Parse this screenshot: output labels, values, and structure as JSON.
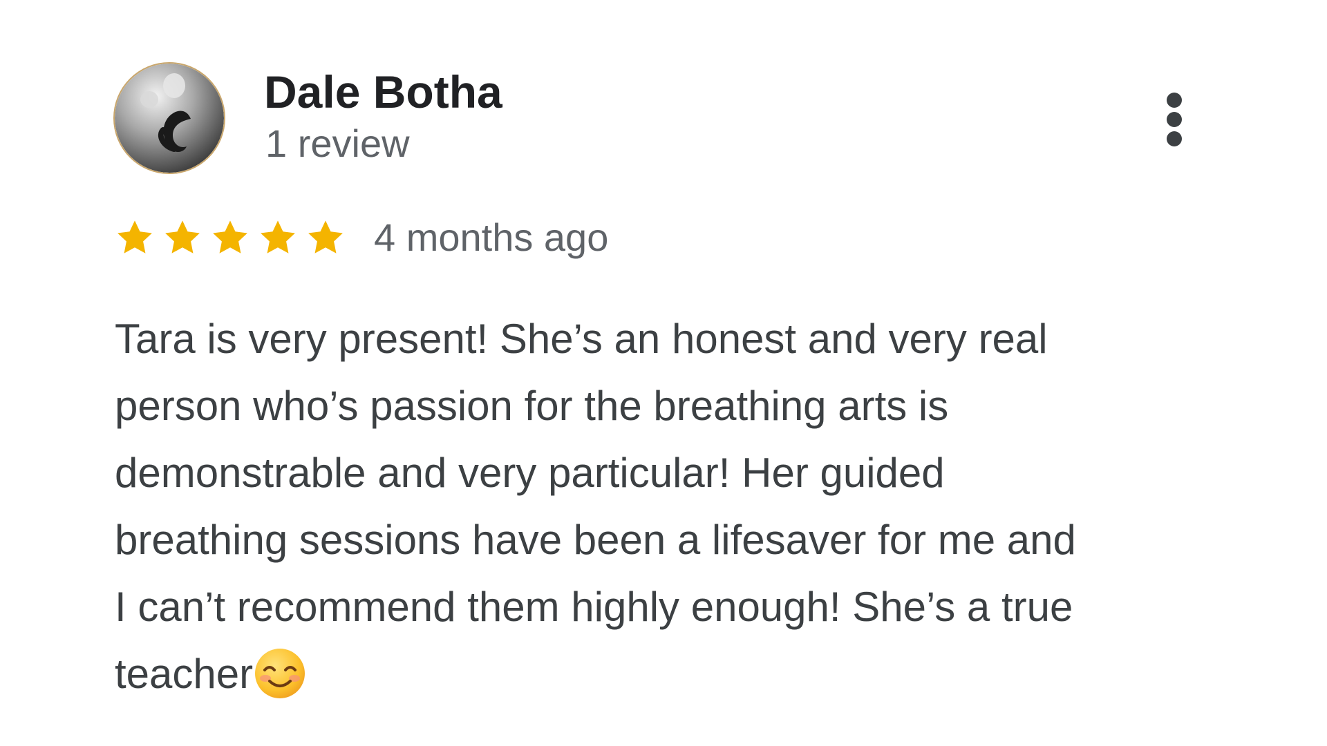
{
  "review": {
    "author_name": "Dale Botha",
    "review_count": "1 review",
    "rating": 5,
    "rating_max": 5,
    "time_ago": "4 months ago",
    "text_lines": [
      "Tara is very present! She’s an honest and very real",
      "person who’s passion for the breathing arts is",
      "demonstrable and very particular! Her guided",
      "breathing sessions have been a lifesaver for me and",
      "I can’t recommend them highly enough! She’s a true",
      "teacher"
    ],
    "trailing_emoji": "smiling-face-with-smiling-eyes"
  },
  "icons": {
    "more_menu": "more-vert-icon",
    "star": "star-icon"
  },
  "colors": {
    "star": "#F4B400",
    "author_name": "#202124",
    "secondary_text": "#5F6368",
    "body_text": "#3C4043",
    "menu_dots": "#3C4043"
  }
}
